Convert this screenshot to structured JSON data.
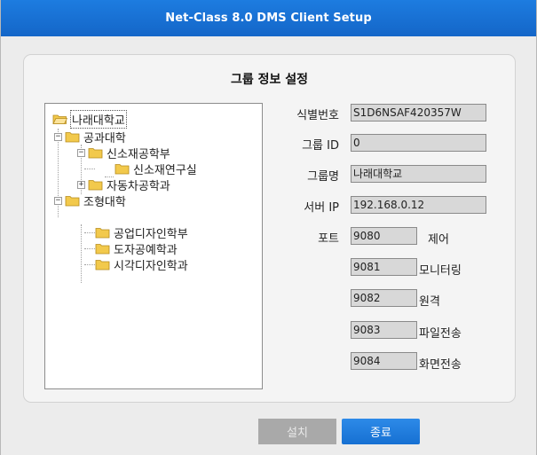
{
  "window": {
    "title": "Net-Class 8.0 DMS Client Setup"
  },
  "panel": {
    "title": "그룹 정보 설정"
  },
  "tree": {
    "root": "나래대학교",
    "nodes": [
      {
        "label": "공과대학",
        "expander": "−"
      },
      {
        "label": "신소재공학부",
        "expander": "−"
      },
      {
        "label": "신소재연구실"
      },
      {
        "label": "자동차공학과",
        "expander": "+"
      },
      {
        "label": "조형대학",
        "expander": "−"
      },
      {
        "label": "공업디자인학부"
      },
      {
        "label": "도자공예학과"
      },
      {
        "label": "시각디자인학과"
      }
    ]
  },
  "fields": {
    "id": {
      "label": "식별번호",
      "value": "S1D6NSAF420357W"
    },
    "group_id": {
      "label": "그룹 ID",
      "value": "0"
    },
    "group_name": {
      "label": "그룹명",
      "value": "나래대학교"
    },
    "server_ip": {
      "label": "서버 IP",
      "value": "192.168.0.12"
    },
    "port_label": "포트",
    "ports": [
      {
        "value": "9080",
        "label": "제어"
      },
      {
        "value": "9081",
        "label": "모니터링"
      },
      {
        "value": "9082",
        "label": "원격"
      },
      {
        "value": "9083",
        "label": "파일전송"
      },
      {
        "value": "9084",
        "label": "화면전송"
      }
    ]
  },
  "buttons": {
    "install": "설치",
    "exit": "종료"
  },
  "colors": {
    "titlebar": "#1670d2",
    "button_active": "#1670d2",
    "button_disabled": "#a9a9a9",
    "folder": "#f2c94c"
  }
}
